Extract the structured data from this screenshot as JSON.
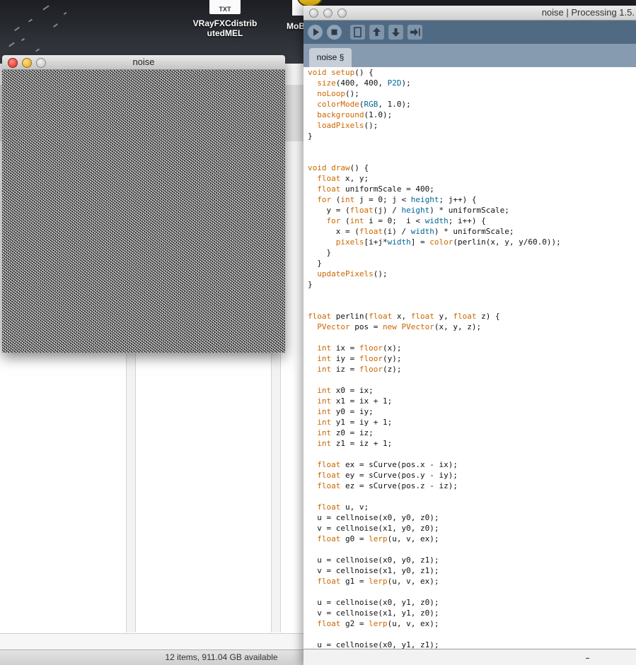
{
  "desktop": {
    "icons": [
      {
        "badge": "TXT",
        "label": "VRayFXCdistrib utedMEL"
      },
      {
        "label": "MoB"
      }
    ]
  },
  "finder": {
    "status": "12 items, 911.04 GB available"
  },
  "sketch_window": {
    "title": "noise"
  },
  "ide": {
    "title": "noise | Processing 1.5.",
    "toolbar": {
      "run_icon": "play-icon",
      "stop_icon": "stop-icon",
      "new_icon": "document-icon",
      "open_icon": "up-arrow-icon",
      "save_icon": "down-arrow-icon",
      "export_icon": "export-icon"
    },
    "tab": "noise §",
    "code": [
      "void setup() {",
      "  size(400, 400, P2D);",
      "  noLoop();",
      "  colorMode(RGB, 1.0);",
      "  background(1.0);",
      "  loadPixels();",
      "}",
      "",
      "",
      "void draw() {",
      "  float x, y;",
      "  float uniformScale = 400;",
      "  for (int j = 0; j < height; j++) {",
      "    y = (float(j) / height) * uniformScale;",
      "    for (int i = 0;  i < width; i++) {",
      "      x = (float(i) / width) * uniformScale;",
      "      pixels[i+j*width] = color(perlin(x, y, y/60.0));",
      "    }",
      "  }",
      "  updatePixels();",
      "}",
      "",
      "",
      "float perlin(float x, float y, float z) {",
      "  PVector pos = new PVector(x, y, z);",
      "",
      "  int ix = floor(x);",
      "  int iy = floor(y);",
      "  int iz = floor(z);",
      "",
      "  int x0 = ix;",
      "  int x1 = ix + 1;",
      "  int y0 = iy;",
      "  int y1 = iy + 1;",
      "  int z0 = iz;",
      "  int z1 = iz + 1;",
      "",
      "  float ex = sCurve(pos.x - ix);",
      "  float ey = sCurve(pos.y - iy);",
      "  float ez = sCurve(pos.z - iz);",
      "",
      "  float u, v;",
      "  u = cellnoise(x0, y0, z0);",
      "  v = cellnoise(x1, y0, z0);",
      "  float g0 = lerp(u, v, ex);",
      "",
      "  u = cellnoise(x0, y0, z1);",
      "  v = cellnoise(x1, y0, z1);",
      "  float g1 = lerp(u, v, ex);",
      "",
      "  u = cellnoise(x0, y1, z0);",
      "  v = cellnoise(x1, y1, z0);",
      "  float g2 = lerp(u, v, ex);",
      "",
      "  u = cellnoise(x0, y1, z1);"
    ],
    "colors": {
      "keyword": "#cc6600",
      "builtin": "#006699",
      "toolbar": "#506a84",
      "tabbar": "#879bb0"
    }
  }
}
